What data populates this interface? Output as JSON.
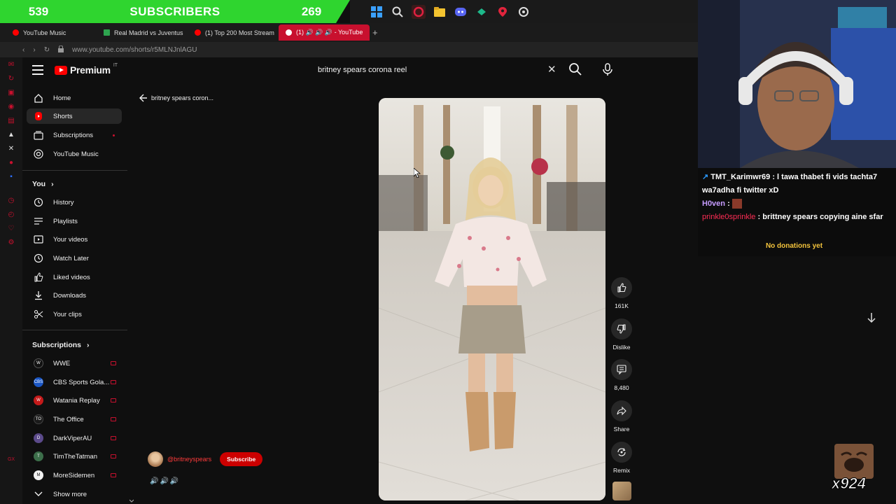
{
  "overlay": {
    "sub_left": "539",
    "sub_title": "SUBSCRIBERS",
    "sub_right": "269",
    "emote_text": "x924"
  },
  "browser": {
    "tabs": [
      {
        "label": "YouTube Music",
        "color": "#ff0000"
      },
      {
        "label": "Real Madrid vs Juventus",
        "color": "#2ea44f"
      },
      {
        "label": "(1) Top 200 Most Stream",
        "color": "#ff0000"
      },
      {
        "label": "(1) 🔊 🔊 🔊 - YouTube",
        "color": "#ffffff"
      }
    ],
    "url": "www.youtube.com/shorts/r5MLNJnlAGU"
  },
  "header": {
    "brand": "Premium",
    "country": "IT",
    "search_query": "britney spears corona reel"
  },
  "guide": {
    "main": [
      {
        "label": "Home",
        "icon": "home-icon"
      },
      {
        "label": "Shorts",
        "icon": "shorts-icon"
      },
      {
        "label": "Subscriptions",
        "icon": "subscriptions-icon"
      },
      {
        "label": "YouTube Music",
        "icon": "youtube-music-icon"
      }
    ],
    "you_label": "You",
    "you": [
      {
        "label": "History",
        "icon": "history-icon"
      },
      {
        "label": "Playlists",
        "icon": "playlists-icon"
      },
      {
        "label": "Your videos",
        "icon": "your-videos-icon"
      },
      {
        "label": "Watch Later",
        "icon": "clock-icon"
      },
      {
        "label": "Liked videos",
        "icon": "thumbs-up-icon"
      },
      {
        "label": "Downloads",
        "icon": "download-icon"
      },
      {
        "label": "Your clips",
        "icon": "scissors-icon"
      }
    ],
    "subs_label": "Subscriptions",
    "channels": [
      {
        "label": "WWE",
        "color": "#111111"
      },
      {
        "label": "CBS Sports Gola...",
        "color": "#1a56c4"
      },
      {
        "label": "Watania Replay",
        "color": "#c41a1a"
      },
      {
        "label": "The Office",
        "color": "#1a1a1a"
      },
      {
        "label": "DarkViperAU",
        "color": "#5b4a8a"
      },
      {
        "label": "TimTheTatman",
        "color": "#3c6e4a"
      },
      {
        "label": "MoreSidemen",
        "color": "#f1f1f1"
      }
    ],
    "show_more": "Show more"
  },
  "short": {
    "title": "britney spears coron...",
    "channel": "@britneyspears",
    "subscribe": "Subscribe",
    "caption": "🔊🔊🔊",
    "actions": {
      "likes": "161K",
      "dislike": "Dislike",
      "comments": "8,480",
      "share": "Share",
      "remix": "Remix"
    }
  },
  "chat": {
    "lines": [
      {
        "name": "TMT_Karimwr69",
        "text": ": l tawa thabet fi vids tachta7 wa7adha fi twitter xD"
      },
      {
        "name": "H0ven",
        "text": ":"
      },
      {
        "name": "prinkle0sprinkle",
        "text": ": brittney spears copying aine sfar"
      }
    ],
    "donations": "No donations yet"
  }
}
